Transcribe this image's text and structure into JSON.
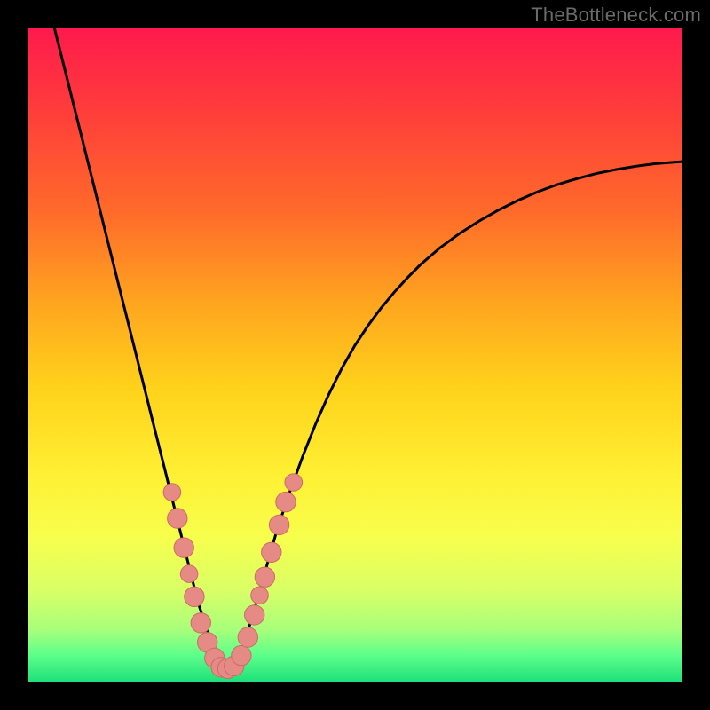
{
  "watermark": "TheBottleneck.com",
  "colors": {
    "frame": "#000000",
    "curve": "#000000",
    "marker_fill": "#e68a86",
    "marker_stroke": "#cc6b66"
  },
  "chart_data": {
    "type": "line",
    "title": "",
    "xlabel": "",
    "ylabel": "",
    "xlim": [
      0,
      100
    ],
    "ylim": [
      0,
      100
    ],
    "grid": false,
    "legend": false,
    "curve_description": "V-shaped bottleneck curve with sharp asymmetric minimum near x≈30; left branch steeper than right; right branch flattens toward top-right.",
    "x": [
      4,
      5,
      6,
      7,
      8,
      9,
      10,
      11,
      12,
      13,
      14,
      15,
      16,
      17,
      18,
      19,
      20,
      21,
      22,
      23,
      24,
      25,
      26,
      27,
      28,
      29,
      30,
      31,
      32,
      33,
      34,
      35,
      36,
      37,
      38,
      39,
      40,
      42,
      44,
      46,
      48,
      50,
      52,
      54,
      56,
      58,
      60,
      63,
      66,
      69,
      72,
      75,
      78,
      81,
      84,
      87,
      90,
      93,
      96,
      100
    ],
    "y": [
      100,
      96.0,
      92.0,
      88.0,
      84.0,
      80.0,
      76.0,
      72.0,
      68.0,
      64.0,
      60.0,
      56.0,
      52.0,
      48.0,
      44.0,
      40.0,
      36.0,
      32.0,
      28.0,
      24.0,
      20.0,
      16.0,
      12.0,
      9.0,
      6.0,
      3.5,
      2.0,
      2.0,
      3.5,
      6.0,
      9.0,
      12.5,
      16.0,
      19.5,
      23.0,
      26.0,
      29.0,
      34.5,
      39.5,
      44.0,
      48.0,
      51.5,
      54.5,
      57.2,
      59.6,
      61.8,
      63.8,
      66.4,
      68.6,
      70.5,
      72.2,
      73.7,
      75.0,
      76.1,
      77.0,
      77.8,
      78.4,
      78.9,
      79.3,
      79.6
    ],
    "markers": [
      {
        "x": 22.0,
        "y": 29.0,
        "r": 1.4
      },
      {
        "x": 22.8,
        "y": 25.0,
        "r": 1.6
      },
      {
        "x": 23.8,
        "y": 20.5,
        "r": 1.6
      },
      {
        "x": 24.6,
        "y": 16.5,
        "r": 1.4
      },
      {
        "x": 25.4,
        "y": 13.0,
        "r": 1.6
      },
      {
        "x": 26.4,
        "y": 9.0,
        "r": 1.6
      },
      {
        "x": 27.4,
        "y": 6.0,
        "r": 1.6
      },
      {
        "x": 28.5,
        "y": 3.6,
        "r": 1.6
      },
      {
        "x": 29.5,
        "y": 2.2,
        "r": 1.6
      },
      {
        "x": 30.5,
        "y": 2.0,
        "r": 1.6
      },
      {
        "x": 31.5,
        "y": 2.4,
        "r": 1.6
      },
      {
        "x": 32.6,
        "y": 4.0,
        "r": 1.6
      },
      {
        "x": 33.6,
        "y": 6.8,
        "r": 1.6
      },
      {
        "x": 34.6,
        "y": 10.2,
        "r": 1.6
      },
      {
        "x": 35.4,
        "y": 13.2,
        "r": 1.4
      },
      {
        "x": 36.2,
        "y": 16.0,
        "r": 1.6
      },
      {
        "x": 37.2,
        "y": 19.8,
        "r": 1.6
      },
      {
        "x": 38.4,
        "y": 24.0,
        "r": 1.6
      },
      {
        "x": 39.4,
        "y": 27.5,
        "r": 1.6
      },
      {
        "x": 40.6,
        "y": 30.5,
        "r": 1.4
      }
    ]
  }
}
